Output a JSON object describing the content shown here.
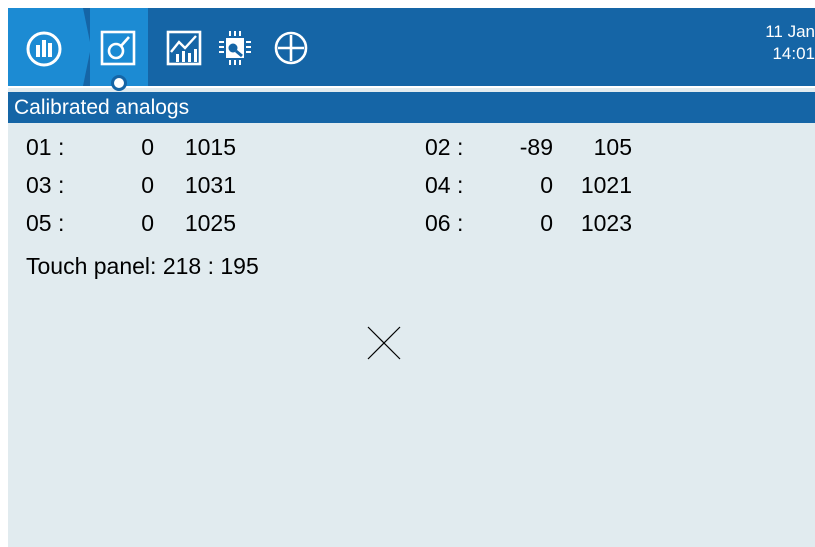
{
  "header": {
    "tabs": [
      {
        "icon": "gauge-icon",
        "active": false
      },
      {
        "icon": "calibration-icon",
        "active": true
      },
      {
        "icon": "chart-icon",
        "active": false
      },
      {
        "icon": "chip-icon",
        "active": false
      },
      {
        "icon": "crosshair-icon",
        "active": false
      }
    ],
    "date": "11 Jan",
    "time": "14:01"
  },
  "section": {
    "title": "Calibrated analogs"
  },
  "channels": [
    {
      "label": "01 :",
      "min": "0",
      "max": "1015"
    },
    {
      "label": "02 :",
      "min": "-89",
      "max": "105"
    },
    {
      "label": "03 :",
      "min": "0",
      "max": "1031"
    },
    {
      "label": "04 :",
      "min": "0",
      "max": "1021"
    },
    {
      "label": "05 :",
      "min": "0",
      "max": "1025"
    },
    {
      "label": "06 :",
      "min": "0",
      "max": "1023"
    }
  ],
  "touch_panel": "Touch panel: 218 : 195",
  "colors": {
    "header_bg": "#1565a6",
    "active_tab_bg": "#1c8bd3",
    "screen_bg": "#e1ebef"
  }
}
